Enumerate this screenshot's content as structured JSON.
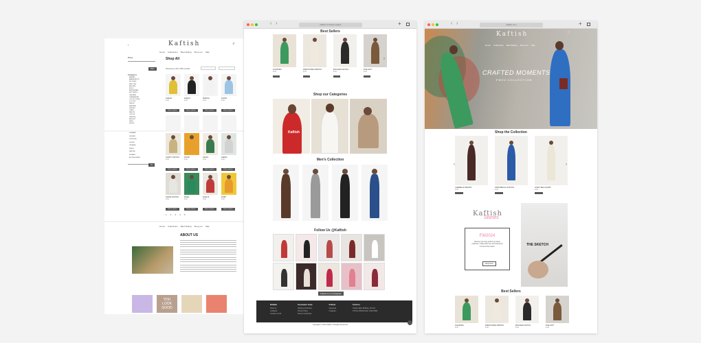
{
  "colors": {
    "accent": "#f07ea0",
    "footer": "#2b2b2b",
    "button": "#555555"
  },
  "left": {
    "brand": "Kaftish",
    "nav": [
      "Home",
      "Collections",
      "Best Selling",
      "Shop our",
      "Sale"
    ],
    "page_title": "Shop All",
    "sort_label": "Showing 1-20 of 80 results",
    "filter_title": "Price",
    "category_title": "Category",
    "categories": [
      "ABAYAS",
      "ABAYA BESTS",
      "BLOUSES",
      "BEST SEL",
      "BESTSEL",
      "BOHO",
      "BRIDESMAID",
      "BUTTERFLY",
      "CAFTANS",
      "CHAMPAGNE",
      "COLLECTIONS",
      "COTTON",
      "DRESS",
      "KAFTANS",
      "KIMONO",
      "LINEN",
      "NEW IN",
      "OUTLET",
      "PRINTED",
      "RESORT",
      "SALE",
      "SHORT"
    ],
    "categories2": [
      "SUMMER",
      "SUNDAY",
      "TROPICAL",
      "VELVET",
      "VINTAGE",
      "WHITE",
      "WINTER",
      "WOMEN",
      "ACCESSORIES"
    ],
    "products": [
      {
        "name": "KHILEA",
        "price": "$ 00"
      },
      {
        "name": "FARAH",
        "price": "$ 00"
      },
      {
        "name": "MORAH",
        "price": "$ 00"
      },
      {
        "name": "NOOR",
        "price": "$ 00"
      }
    ],
    "products2": [
      {
        "name": "SUNNY KAFTAN",
        "price": "$ 00"
      },
      {
        "name": "NOUR",
        "price": "$ 00"
      },
      {
        "name": "SAFFA",
        "price": "$ 00"
      },
      {
        "name": "LEENA",
        "price": "$ 00"
      },
      {
        "name": "SHOW KAFTAN",
        "price": "$ 00"
      },
      {
        "name": "RIHAL",
        "price": "$ 00"
      },
      {
        "name": "DHALIA",
        "price": "$ 00"
      },
      {
        "name": "RUBY",
        "price": "$ 00"
      }
    ],
    "btn": "Select options",
    "pagination": [
      "1",
      "2",
      "3",
      "4",
      "5"
    ],
    "about_title": "ABOUT US",
    "about_nav": [
      "Home",
      "Collections",
      "Best Selling",
      "Shop our",
      "Sale"
    ]
  },
  "middle": {
    "url": "kaftish.com/best-sellers",
    "best_sellers": "Best Sellers",
    "best": [
      {
        "name": "KHUZAMA",
        "price": "$ 00"
      },
      {
        "name": "FIRDOUSSIE KIMONO",
        "price": "$ 00"
      },
      {
        "name": "MOUJER KAFTAN",
        "price": "$ 00"
      },
      {
        "name": "DUE GIFT",
        "price": "$ 00"
      }
    ],
    "categories": "Shop our Categories",
    "cat_badge": "Kaftish",
    "mens": "Men's Collection",
    "follow": "Follow Us @Kaftish",
    "follow_btn": "Follow us on Instagram",
    "footer": {
      "cols": [
        {
          "title": "Kaftish",
          "items": [
            "About us",
            "Lookbook",
            "Contact us 123"
          ]
        },
        {
          "title": "Customer Care",
          "items": [
            "Shipping & Delivery",
            "Privacy Policy",
            "Returns & Refunds"
          ]
        },
        {
          "title": "Follow",
          "items": [
            "Facebook",
            "Instagram"
          ]
        },
        {
          "title": "Find us",
          "items": [
            "Dubai Ladies Building, 1st floor",
            "PO Box 00000 Dubai, UAE 00000"
          ]
        }
      ],
      "copyright": "Copyright © 2024 Kaftish. All Rights Reserved"
    }
  },
  "right": {
    "url": "kaftish.com",
    "brand": "Kaftish",
    "nav": [
      "Home",
      "Collections",
      "Best Selling",
      "Shop our",
      "Sale"
    ],
    "hero_title": "CRAFTED MOMENTS",
    "hero_sub": "FW24 COLLECTION",
    "collection_title": "Shop the Collection",
    "collection": [
      {
        "name": "CHEMELIA KIMONO",
        "price": "$ 00"
      },
      {
        "name": "SAPPHIRICAL KAFTAN",
        "price": "$ 00"
      },
      {
        "name": "IVORY BALLGOWN",
        "price": "$ 00"
      }
    ],
    "logo": "Kaftish",
    "logo_script": "Stories",
    "fw_title": "FW2024",
    "fw_text": "Discover the story behind our latest collection, crafted with love and inspired by moments that matter.",
    "fw_btn": "Shop Now",
    "sketch": "THE SKETCH",
    "best_title": "Best Sellers",
    "best": [
      {
        "name": "KHUZAMA",
        "price": "$ 00"
      },
      {
        "name": "FIRDOUSSIE KIMONO",
        "price": "$ 00"
      },
      {
        "name": "MOUJER KAFTAN",
        "price": "$ 00"
      },
      {
        "name": "DUE GIFT",
        "price": "$ 00"
      }
    ]
  }
}
